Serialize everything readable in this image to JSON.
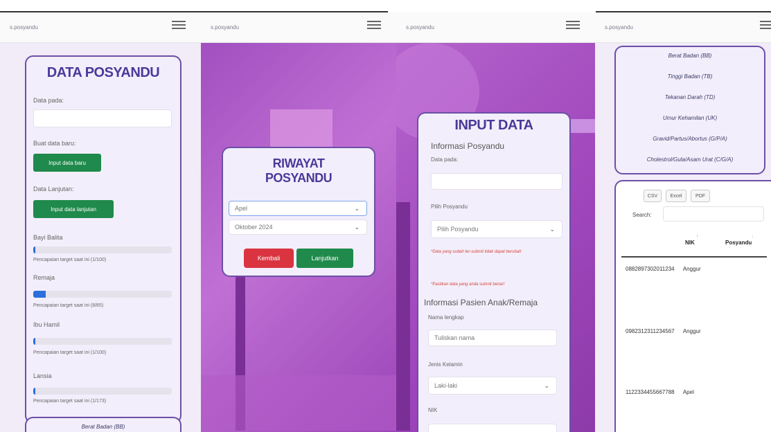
{
  "brand": "s.posyandu",
  "panel1": {
    "title": "DATA POSYANDU",
    "data_pada_label": "Data pada:",
    "buat_baru_label": "Buat data baru:",
    "input_baru_button": "Input data baru",
    "lanjutan_label": "Data Lanjutan:",
    "input_lanjutan_button": "Input data lanjutan",
    "progress": [
      {
        "label": "Bayi Balita",
        "note": "Pencapaian target saat ini (1/100)",
        "value": 0.01
      },
      {
        "label": "Remaja",
        "note": "Pencapaian target saat ini (8/85)",
        "value": 0.09
      },
      {
        "label": "Ibu Hamil",
        "note": "Pencapaian target saat ini (1/100)",
        "value": 0.01
      },
      {
        "label": "Lansia",
        "note": "Pencapaian target saat ini (1/173)",
        "value": 0.006
      }
    ],
    "bottom_card_title": "Berat Badan (BB)"
  },
  "panel2": {
    "title_line1": "RIWAYAT",
    "title_line2": "POSYANDU",
    "select_posyandu": "Apel",
    "select_bulan": "Oktober 2024",
    "kembali_button": "Kembali",
    "lanjutkan_button": "Lanjutkan"
  },
  "panel3": {
    "title": "INPUT DATA",
    "section1": "Informasi Posyandu",
    "data_pada_label": "Data pada:",
    "pilih_label": "Pilih Posyandu",
    "pilih_value": "Pilih Posyandu",
    "warn1": "*Data yang sudah ter-submit tidak dapat berubah",
    "warn2": "*Pastikan data yang anda submit benar!",
    "section2": "Informasi Pasien Anak/Remaja",
    "nama_label": "Nama lengkap",
    "nama_placeholder": "Tuliskan nama",
    "jk_label": "Jenis Kelamin",
    "jk_value": "Laki-laki",
    "nik_label": "NIK"
  },
  "panel4": {
    "cm_items": [
      "Berat Badan (BB)",
      "Tinggi Badan (TB)",
      "Tekanan Darah (TD)",
      "Umur Kehamilan (UK)",
      "Gravid/Partus/Abortus (G/P/A)",
      "Cholestrol/Gula/Asam Urat (C/G/A)"
    ],
    "buttons": [
      "CSV",
      "Excel",
      "PDF"
    ],
    "search_label": "Search:",
    "col_nik": "NIK",
    "col_posyandu": "Posyandu",
    "rows": [
      {
        "nik": "0882897302011234",
        "posyandu": "Anggur"
      },
      {
        "nik": "0982312311234567",
        "posyandu": "Anggur"
      },
      {
        "nik": "1122334455667788",
        "posyandu": "Apel"
      }
    ]
  },
  "colors": {
    "accent": "#4a3a99",
    "green": "#1f8a4b",
    "red": "#d93440",
    "bg": "#f2ebf8"
  }
}
